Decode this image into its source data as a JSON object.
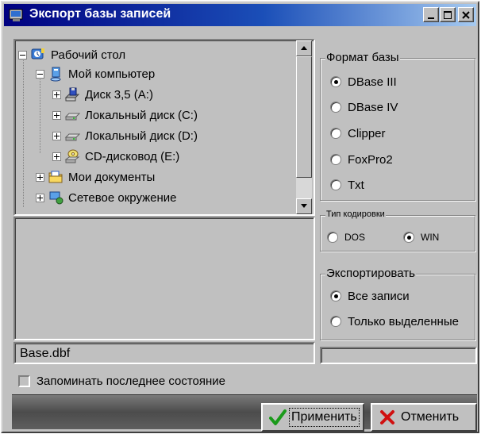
{
  "window": {
    "title": "Экспорт базы записей"
  },
  "tree": {
    "items": [
      {
        "label": "Рабочий стол",
        "icon": "desktop-icon",
        "level": 0,
        "expander": "minus"
      },
      {
        "label": "Мой компьютер",
        "icon": "computer-icon",
        "level": 1,
        "expander": "minus"
      },
      {
        "label": "Диск 3,5 (A:)",
        "icon": "floppy-drive-icon",
        "level": 2,
        "expander": "plus"
      },
      {
        "label": "Локальный диск (C:)",
        "icon": "hard-drive-icon",
        "level": 2,
        "expander": "plus"
      },
      {
        "label": "Локальный диск (D:)",
        "icon": "hard-drive-icon",
        "level": 2,
        "expander": "plus"
      },
      {
        "label": "CD-дисковод (E:)",
        "icon": "cd-drive-icon",
        "level": 2,
        "expander": "plus"
      },
      {
        "label": "Мои документы",
        "icon": "folder-icon",
        "level": 1,
        "expander": "plus"
      },
      {
        "label": "Сетевое окружение",
        "icon": "network-icon",
        "level": 1,
        "expander": "plus"
      }
    ]
  },
  "filename": "Base.dbf",
  "format_group": {
    "legend": "Формат базы",
    "options": [
      "DBase III",
      "DBase IV",
      "Clipper",
      "FoxPro2",
      "Txt"
    ],
    "selected": "DBase III"
  },
  "encoding_group": {
    "legend": "Тип кодировки",
    "options": [
      "DOS",
      "WIN"
    ],
    "selected": "WIN"
  },
  "export_group": {
    "legend": "Экспортировать",
    "options": [
      "Все записи",
      "Только выделенные"
    ],
    "selected": "Все записи"
  },
  "remember_state": {
    "label": "Запоминать последнее состояние",
    "checked": false
  },
  "buttons": {
    "apply": "Применить",
    "cancel": "Отменить"
  },
  "colors": {
    "title_start": "#000080",
    "title_end": "#a6caf0",
    "face": "#c0c0c0",
    "apply_check": "#1a9a1a",
    "cancel_x": "#d01010"
  }
}
